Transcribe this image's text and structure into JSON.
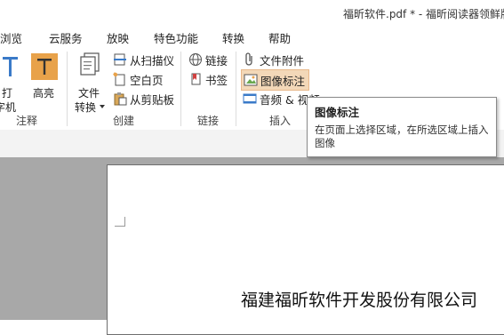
{
  "window": {
    "title": "福昕软件.pdf * - 福昕阅读器领鲜版"
  },
  "menu": [
    {
      "label": "浏览"
    },
    {
      "label": "云服务"
    },
    {
      "label": "放映"
    },
    {
      "label": "特色功能"
    },
    {
      "label": "转换"
    },
    {
      "label": "帮助"
    }
  ],
  "ribbon": {
    "annotate": {
      "group_label": "注释",
      "typewriter_label_1": "打",
      "typewriter_label_2": "字机",
      "highlight_label": "高亮"
    },
    "create": {
      "group_label": "创建",
      "convert_label_1": "文件",
      "convert_label_2": "转换",
      "from_scanner": "从扫描仪",
      "blank_page": "空白页",
      "from_clipboard": "从剪贴板"
    },
    "links": {
      "group_label": "链接",
      "link": "链接",
      "bookmark": "书签"
    },
    "insert": {
      "group_label": "插入",
      "attachment": "文件附件",
      "image_annotation": "图像标注",
      "audio_video": "音频 & 视频"
    }
  },
  "tooltip": {
    "title": "图像标注",
    "description": "在页面上选择区域，在所选区域上插入图像"
  },
  "document": {
    "company_name": "福建福昕软件开发股份有限公司"
  },
  "colors": {
    "accent_orange": "#e8a24a",
    "highlight_bg": "#f3d8b8",
    "doc_background": "#a8a8a8"
  }
}
